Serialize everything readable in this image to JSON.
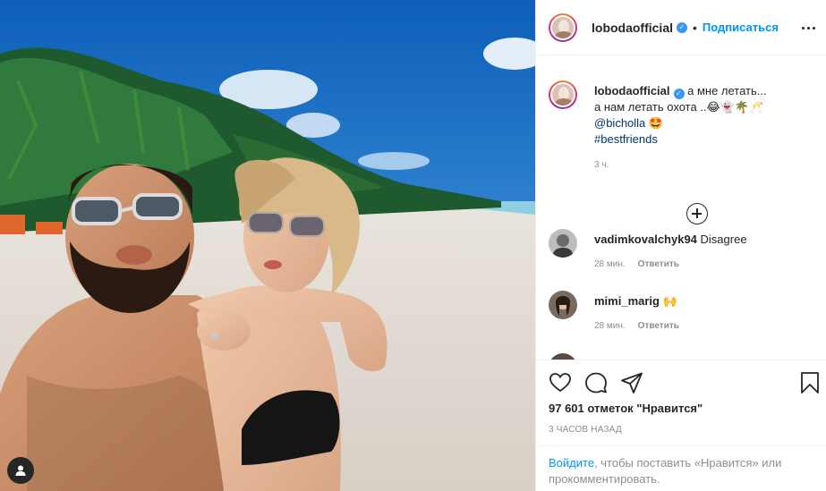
{
  "post": {
    "username": "lobodaofficial",
    "follow_label": "Подписаться",
    "dot": "•"
  },
  "caption": {
    "username": "lobodaofficial",
    "text_line1": "а мне летать...",
    "text_line2": "а нам летать охота ..😂👻🌴🥂",
    "mention": "@bicholla",
    "mention_emoji": "🤩",
    "hashtag": "#bestfriends",
    "time": "3 ч."
  },
  "comments": [
    {
      "username": "vadimkovalchyk94",
      "text": "Disagree",
      "time": "28 мин.",
      "reply_label": "Ответить"
    },
    {
      "username": "mimi_marig",
      "text": "🙌",
      "time": "28 мин.",
      "reply_label": "Ответить"
    }
  ],
  "actions": {
    "likes": "97 601 отметок \"Нравится\"",
    "time_ago": "3 часов назад"
  },
  "login_prompt": {
    "link": "Войдите",
    "text": ", чтобы поставить «Нравится» или прокомментировать."
  },
  "icons": {
    "verified": "verified-badge-icon",
    "more": "more-options-icon",
    "add": "add-circle-icon",
    "like": "heart-icon",
    "comment": "comment-icon",
    "share": "paper-plane-icon",
    "save": "bookmark-icon",
    "user_tag": "user-tag-icon"
  },
  "colors": {
    "accent": "#0095f6",
    "verified": "#3897f0",
    "text": "#262626",
    "muted": "#8e8e8e"
  }
}
